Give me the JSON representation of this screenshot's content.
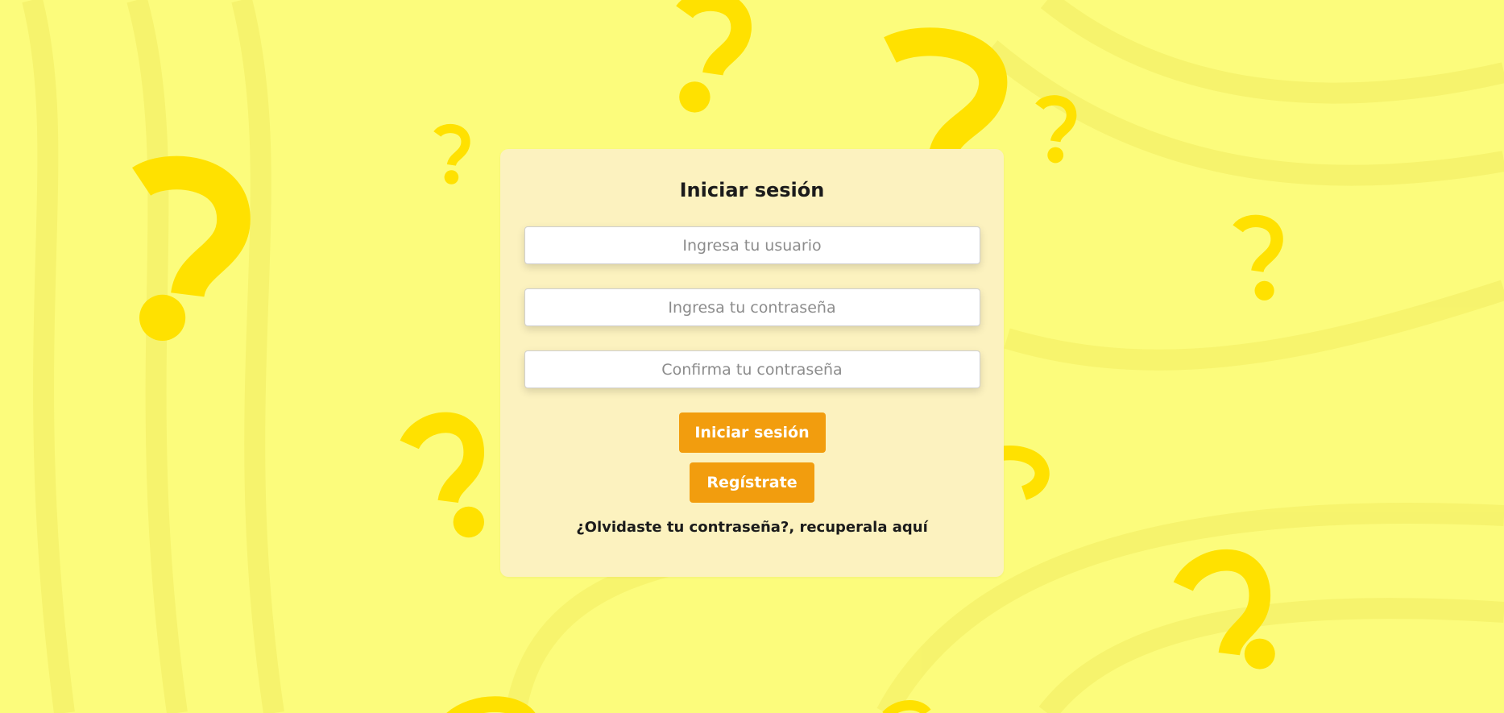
{
  "background": {
    "color": "#fcfc7c",
    "swirl_color": "#f7f46a",
    "question_mark_color": "#ffe100",
    "decoration_icon": "question-mark-icon"
  },
  "login": {
    "title": "Iniciar sesión",
    "username_placeholder": "Ingresa tu usuario",
    "password_placeholder": "Ingresa tu contraseña",
    "confirm_placeholder": "Confirma tu contraseña",
    "login_button": "Iniciar sesión",
    "register_button": "Regístrate",
    "forgot_link": "¿Olvidaste tu contraseña?, recuperala aquí",
    "card_color": "#fcf2bf",
    "button_color": "#f29d0e"
  }
}
